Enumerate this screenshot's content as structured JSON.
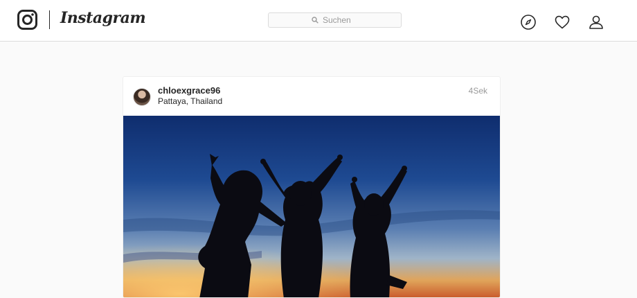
{
  "header": {
    "logo_icon": "instagram-camera-icon",
    "wordmark": "Instagram",
    "search": {
      "placeholder": "Suchen",
      "icon": "search-icon"
    },
    "nav": [
      {
        "name": "explore",
        "icon": "compass-icon"
      },
      {
        "name": "activity",
        "icon": "heart-icon"
      },
      {
        "name": "profile",
        "icon": "person-icon"
      }
    ]
  },
  "post": {
    "username": "chloexgrace96",
    "location": "Pattaya, Thailand",
    "timestamp": "4Sek",
    "avatar": "user-avatar",
    "image": "photo-silhouettes-jumping-at-sunset"
  },
  "colors": {
    "background": "#fafafa",
    "border": "#dbdbdb",
    "text": "#262626",
    "muted": "#999999"
  }
}
